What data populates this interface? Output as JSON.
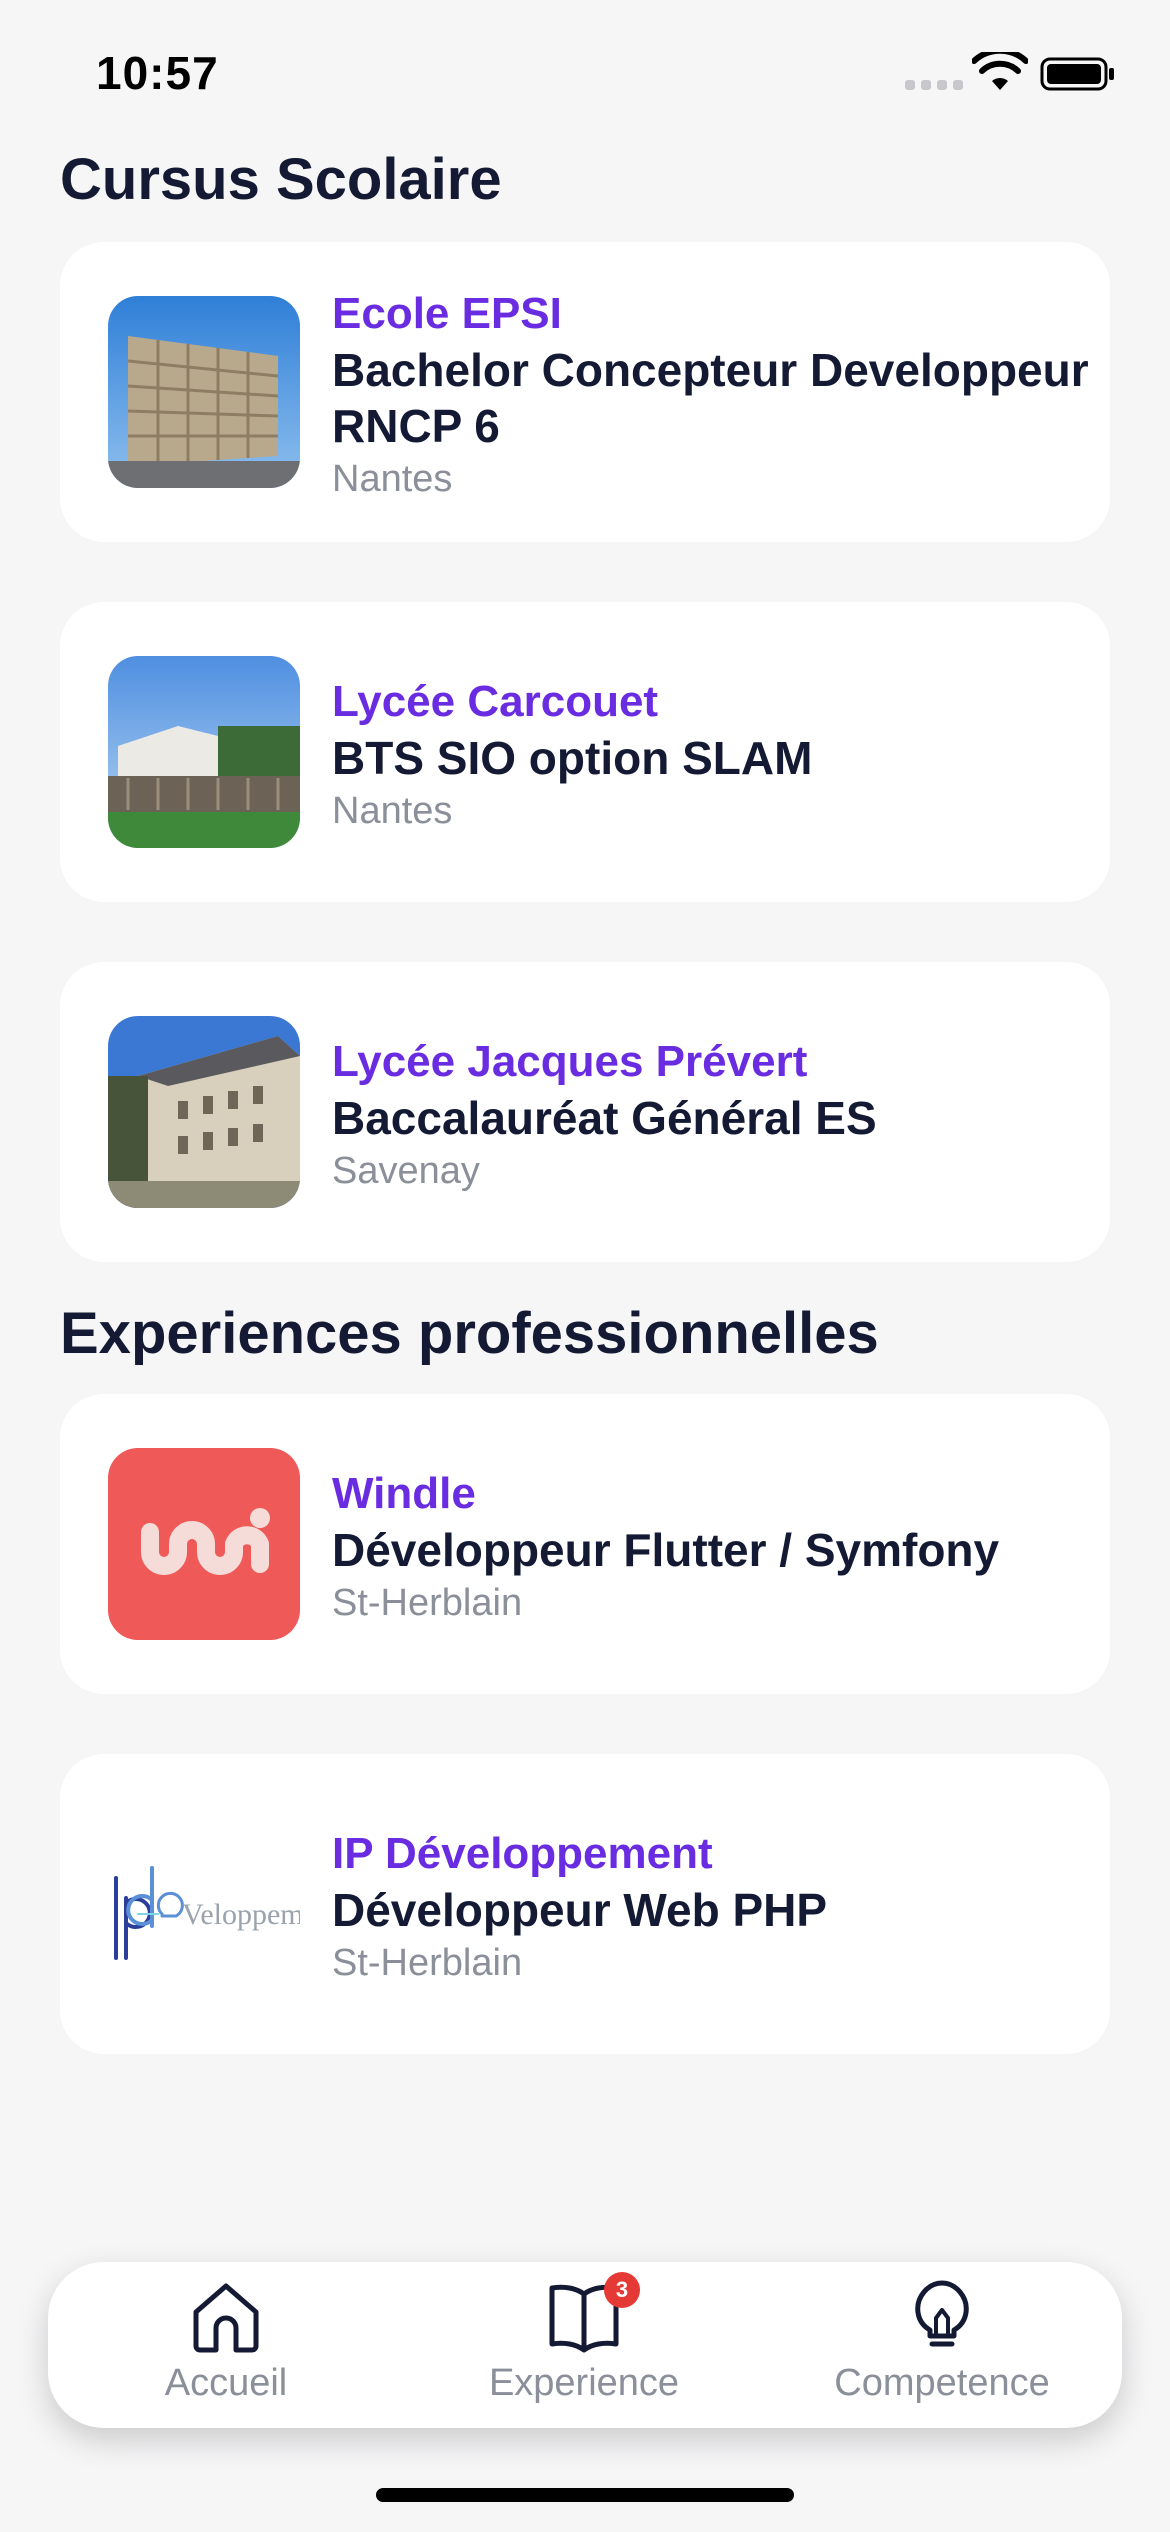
{
  "status_bar": {
    "time": "10:57"
  },
  "education": {
    "title": "Cursus Scolaire",
    "items": [
      {
        "school": "Ecole EPSI",
        "degree": "Bachelor Concepteur Developpeur RNCP 6",
        "city": "Nantes"
      },
      {
        "school": "Lycée Carcouet",
        "degree": "BTS SIO option SLAM",
        "city": "Nantes"
      },
      {
        "school": "Lycée Jacques Prévert",
        "degree": "Baccalauréat Général ES",
        "city": "Savenay"
      }
    ]
  },
  "experience": {
    "title": "Experiences professionnelles",
    "items": [
      {
        "company": "Windle",
        "role": "Développeur Flutter / Symfony",
        "city": "St-Herblain",
        "brand_color": "#ef5a59"
      },
      {
        "company": "IP Développement",
        "role": "Développeur Web PHP",
        "city": "St-Herblain"
      }
    ]
  },
  "tab_bar": {
    "tabs": [
      {
        "label": "Accueil",
        "icon": "home-icon"
      },
      {
        "label": "Experience",
        "icon": "book-icon",
        "badge": "3"
      },
      {
        "label": "Competence",
        "icon": "lightbulb-icon"
      }
    ]
  },
  "colors": {
    "accent": "#6a2ce0",
    "text_primary": "#141a33",
    "text_secondary": "#8a8f99",
    "background": "#f6f6f7",
    "badge": "#e53935"
  }
}
